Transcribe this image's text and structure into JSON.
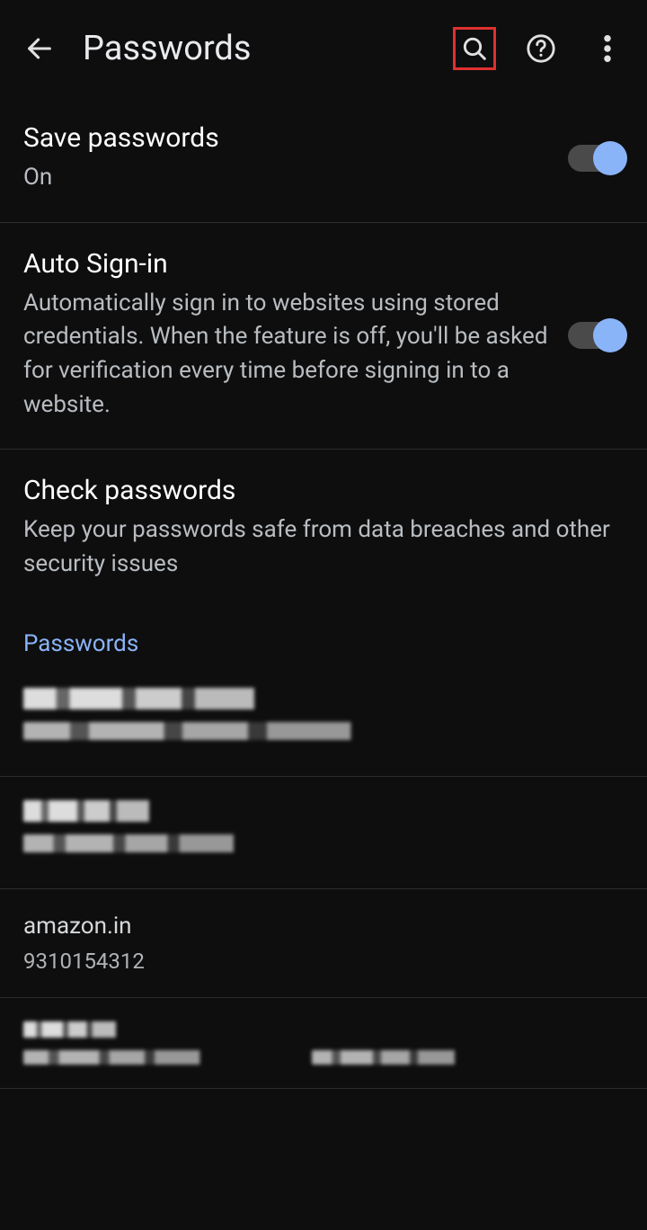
{
  "header": {
    "title": "Passwords"
  },
  "savePasswords": {
    "title": "Save passwords",
    "status": "On",
    "enabled": true
  },
  "autoSignIn": {
    "title": "Auto Sign-in",
    "description": "Automatically sign in to websites using stored credentials. When the feature is off, you'll be asked for verification every time before signing in to a website.",
    "enabled": true
  },
  "checkPasswords": {
    "title": "Check passwords",
    "description": "Keep your passwords safe from data breaches and other security issues"
  },
  "passwordsSection": {
    "label": "Passwords"
  },
  "entries": [
    {
      "site": "[redacted]",
      "user": "[redacted]"
    },
    {
      "site": "[redacted]",
      "user": "[redacted]"
    },
    {
      "site": "amazon.in",
      "user": "9310154312"
    },
    {
      "site": "[redacted]",
      "user": "[redacted]"
    }
  ]
}
